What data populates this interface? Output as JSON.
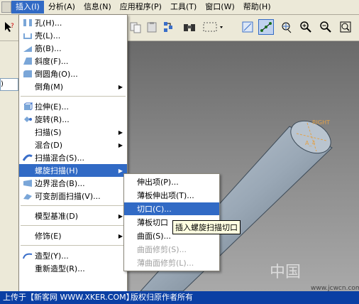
{
  "menubar": {
    "items": [
      {
        "label": "插入(I)",
        "active": true
      },
      {
        "label": "分析(A)",
        "active": false
      },
      {
        "label": "信息(N)",
        "active": false
      },
      {
        "label": "应用程序(P)",
        "active": false
      },
      {
        "label": "工具(T)",
        "active": false
      },
      {
        "label": "窗口(W)",
        "active": false
      },
      {
        "label": "帮助(H)",
        "active": false
      }
    ]
  },
  "left": {
    "select_value": ")"
  },
  "insert_menu": {
    "items": [
      {
        "label": "孔(H)...",
        "icon": "hole-icon"
      },
      {
        "label": "壳(L)...",
        "icon": "shell-icon"
      },
      {
        "label": "筋(B)...",
        "icon": "rib-icon"
      },
      {
        "label": "斜度(F)...",
        "icon": "draft-icon"
      },
      {
        "label": "倒圆角(O)...",
        "icon": "round-icon"
      },
      {
        "label": "倒角(M)",
        "icon": "",
        "arrow": "▶"
      },
      {
        "label": "拉伸(E)...",
        "icon": "extrude-icon"
      },
      {
        "label": "旋转(R)...",
        "icon": "revolve-icon"
      },
      {
        "label": "扫描(S)",
        "icon": "",
        "arrow": "▶"
      },
      {
        "label": "混合(D)",
        "icon": "",
        "arrow": "▶"
      },
      {
        "label": "扫描混合(S)...",
        "icon": "swept-blend-icon"
      },
      {
        "label": "螺旋扫描(H)",
        "icon": "",
        "arrow": "▶",
        "highlight": true
      },
      {
        "label": "边界混合(B)...",
        "icon": "boundary-blend-icon"
      },
      {
        "label": "可变剖面扫描(V)...",
        "icon": "var-sweep-icon"
      },
      {
        "label": "模型基准(D)",
        "icon": "",
        "arrow": "▶"
      },
      {
        "label": "修饰(E)",
        "icon": "",
        "arrow": "▶"
      },
      {
        "label": "造型(Y)...",
        "icon": "style-icon"
      },
      {
        "label": "重新造型(R)...",
        "icon": ""
      }
    ]
  },
  "helical_submenu": {
    "items": [
      {
        "label": "伸出项(P)...",
        "disabled": false
      },
      {
        "label": "薄板伸出项(T)...",
        "disabled": false
      },
      {
        "label": "切口(C)...",
        "disabled": false,
        "highlight": true
      },
      {
        "label": "薄板切口",
        "disabled": false
      },
      {
        "label": "曲面(S)...",
        "disabled": false
      },
      {
        "label": "曲面修剪(S)...",
        "disabled": true
      },
      {
        "label": "薄曲面修剪(L)...",
        "disabled": true
      }
    ]
  },
  "tooltip": "插入螺旋扫描切口",
  "model": {
    "label": "RIGHT",
    "axis": "A_4"
  },
  "status_bar": {
    "left": "上传于【新客网 WWW.XKER.COM】",
    "right": "版权归原作者所有"
  },
  "watermark": {
    "text": "中国",
    "site": "www.jcwcn.com"
  },
  "colors": {
    "highlight": "#316ac5",
    "status": "#0a3fa4"
  }
}
